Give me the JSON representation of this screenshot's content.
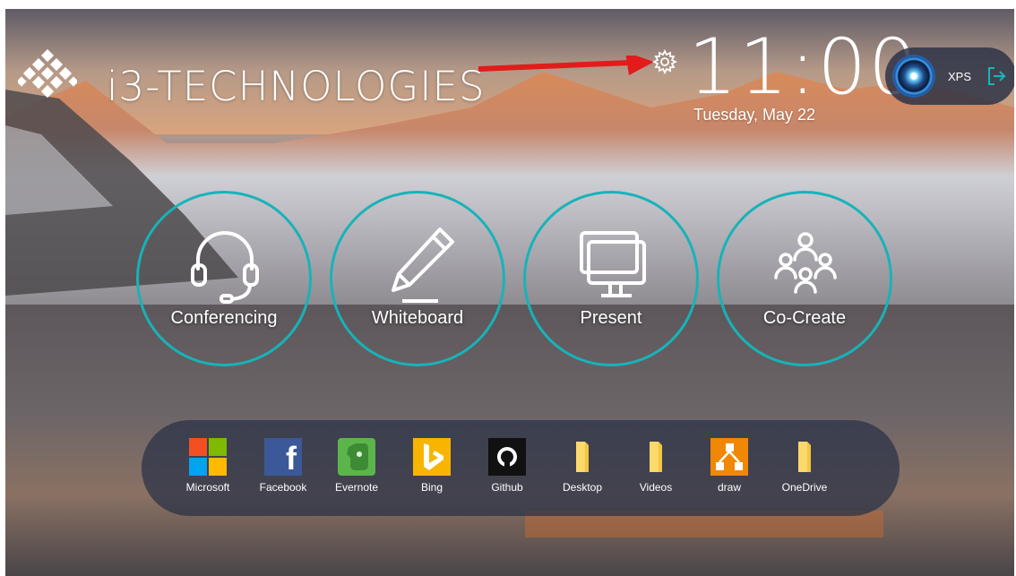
{
  "header": {
    "brand": "i3-TECHNOLOGIES",
    "time": "11:00",
    "date": "Tuesday, May 22",
    "user_name": "XPS"
  },
  "actions": [
    {
      "label": "Conferencing",
      "icon": "headset-icon"
    },
    {
      "label": "Whiteboard",
      "icon": "pencil-icon"
    },
    {
      "label": "Present",
      "icon": "monitor-icon"
    },
    {
      "label": "Co-Create",
      "icon": "people-group-icon"
    }
  ],
  "dock": {
    "apps": [
      {
        "label": "Microsoft",
        "icon": "microsoft-icon"
      },
      {
        "label": "Facebook",
        "icon": "facebook-icon"
      },
      {
        "label": "Evernote",
        "icon": "evernote-icon"
      },
      {
        "label": "Bing",
        "icon": "bing-icon"
      },
      {
        "label": "Github",
        "icon": "github-icon"
      },
      {
        "label": "Desktop",
        "icon": "folder-icon"
      },
      {
        "label": "Videos",
        "icon": "folder-icon"
      },
      {
        "label": "draw",
        "icon": "draw-icon"
      },
      {
        "label": "OneDrive",
        "icon": "folder-icon"
      }
    ]
  },
  "colors": {
    "accent": "#17b3b8",
    "arrow": "#e31b1b",
    "dock_bg": "#283046"
  }
}
